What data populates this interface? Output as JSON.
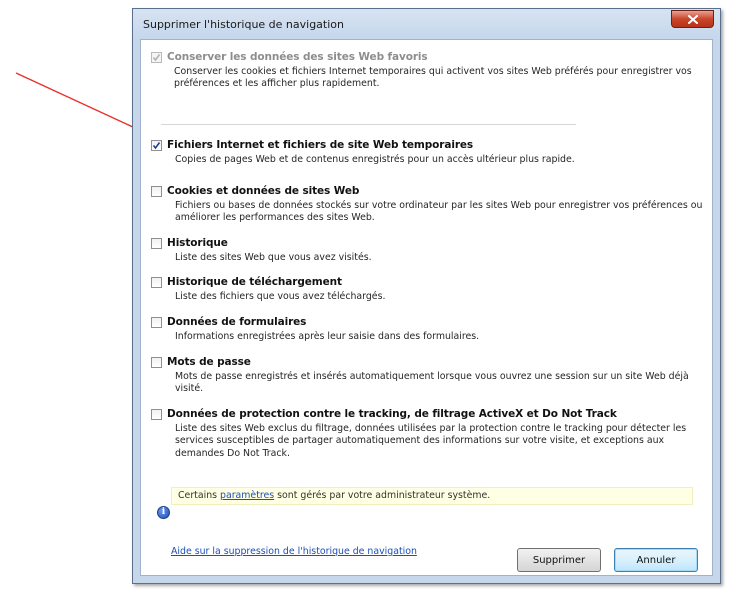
{
  "window": {
    "title": "Supprimer l'historique de navigation",
    "close_icon": "close-icon"
  },
  "options": [
    {
      "title": "Conserver les données des sites Web favoris",
      "description": "Conserver les cookies et fichiers Internet temporaires qui activent vos sites Web préférés pour enregistrer vos préférences et les afficher plus rapidement.",
      "checked": true,
      "disabled": true
    },
    {
      "title": "Fichiers Internet et fichiers de site Web temporaires",
      "description": "Copies de pages Web et de contenus enregistrés pour un accès ultérieur plus rapide.",
      "checked": true,
      "disabled": false
    },
    {
      "title": "Cookies et données de sites Web",
      "description": "Fichiers ou bases de données stockés sur votre ordinateur par les sites Web pour enregistrer vos préférences ou améliorer les performances des sites Web.",
      "checked": false,
      "disabled": false
    },
    {
      "title": "Historique",
      "description": "Liste des sites Web que vous avez visités.",
      "checked": false,
      "disabled": false
    },
    {
      "title": "Historique de téléchargement",
      "description": "Liste des fichiers que vous avez téléchargés.",
      "checked": false,
      "disabled": false
    },
    {
      "title": "Données de formulaires",
      "description": "Informations enregistrées après leur saisie dans des formulaires.",
      "checked": false,
      "disabled": false
    },
    {
      "title": "Mots de passe",
      "description": "Mots de passe enregistrés et insérés automatiquement lorsque vous ouvrez une session sur un site Web déjà visité.",
      "checked": false,
      "disabled": false
    },
    {
      "title": "Données de protection contre le tracking, de filtrage ActiveX et Do Not Track",
      "description": "Liste des sites Web exclus du filtrage, données utilisées par la protection contre le tracking pour détecter les services susceptibles de partager automatiquement des informations sur votre visite, et exceptions aux demandes Do Not Track.",
      "checked": false,
      "disabled": false
    }
  ],
  "notice": {
    "before": "Certains ",
    "link": "paramètres",
    "after": " sont gérés par votre administrateur système.",
    "icon": "info-icon",
    "background": "#ffffe3"
  },
  "footer": {
    "help_link": "Aide sur la suppression de l'historique de navigation",
    "delete_button": "Supprimer",
    "cancel_button": "Annuler"
  },
  "annotation": {
    "arrow_color": "#e8312a",
    "icon": "arrow-icon"
  }
}
